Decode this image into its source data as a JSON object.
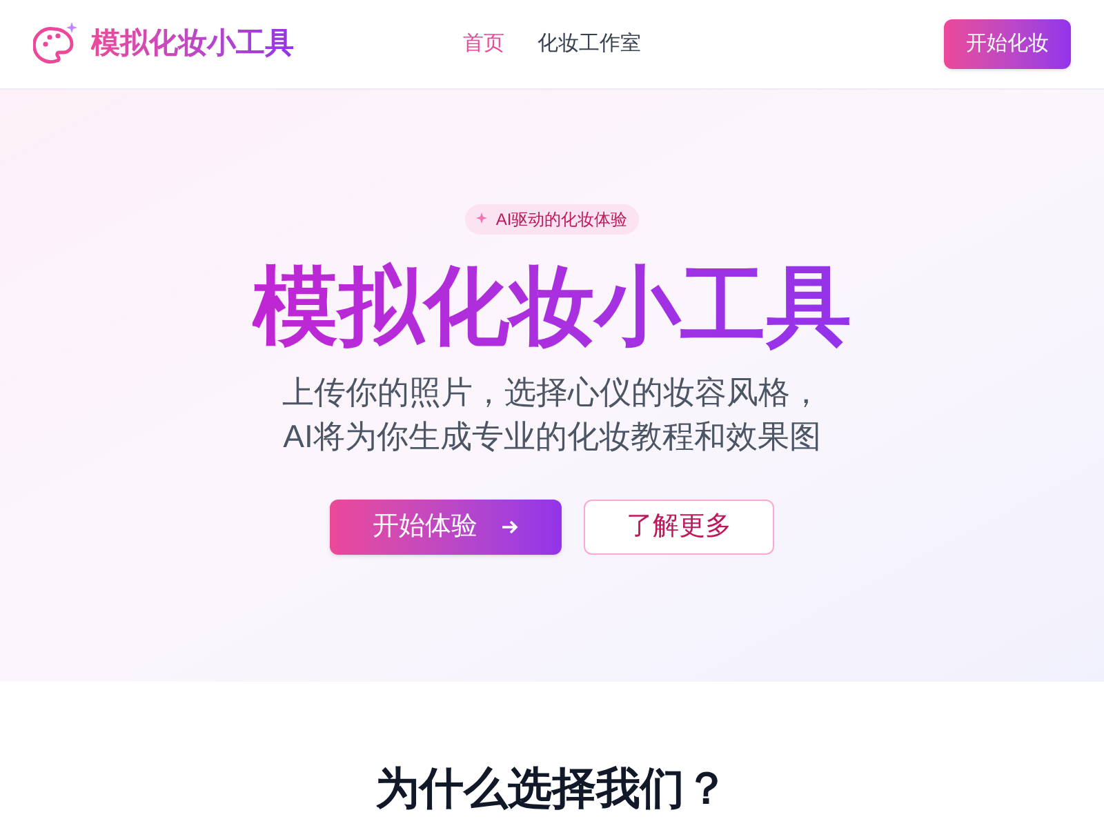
{
  "header": {
    "logo": "模拟化妆小工具",
    "nav": [
      {
        "label": "首页",
        "selected": true
      },
      {
        "label": "化妆工作室",
        "selected": false
      }
    ],
    "cta": "开始化妆"
  },
  "hero": {
    "badge": "AI驱动的化妆体验",
    "title": "模拟化妆小工具",
    "subtitle": [
      "上传你的照片，选择心仪的妆容风格，",
      "AI将为你生成专业的化妆教程和效果图"
    ],
    "buttons": [
      {
        "label": "开始体验",
        "kind": "primary"
      },
      {
        "label": "了解更多",
        "kind": "outline"
      }
    ]
  },
  "features": {
    "title": "为什么选择我们？"
  }
}
